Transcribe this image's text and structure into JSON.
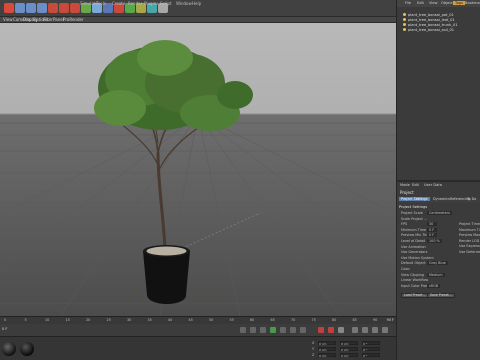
{
  "toolbar": {
    "menus": [
      "Simulate",
      "Tools",
      "Create",
      "Render",
      "Plugins",
      "Script",
      "Window",
      "Help"
    ],
    "icon_colors": [
      "#d94a3a",
      "#6a8fc8",
      "#6a8fc8",
      "#6a8fc8",
      "#c84a3a",
      "#c84a3a",
      "#c84a3a",
      "#68a848",
      "#7aa8d8",
      "#5a78b8",
      "#c84a3a",
      "#58a848",
      "#a8a848",
      "#48a8a8",
      "#a8a8a8"
    ]
  },
  "viewport": {
    "menubar": [
      "View",
      "Cameras",
      "Display",
      "Options",
      "Filter",
      "Panel",
      "ProRender"
    ]
  },
  "object_manager": {
    "tabs": [
      "File",
      "Edit",
      "View",
      "Objects",
      "Tags",
      "Bookmarks"
    ],
    "active_tab": "Tags",
    "objects": [
      {
        "name": "plant_tree_bonsai_pot_01",
        "color": "#e8c060"
      },
      {
        "name": "plant_tree_bonsai_leaf_01",
        "color": "#e8c060"
      },
      {
        "name": "plant_tree_bonsai_trunk_01",
        "color": "#e8c060"
      },
      {
        "name": "plant_tree_bonsai_soil_01",
        "color": "#e8c060"
      }
    ]
  },
  "attributes": {
    "tabs": [
      "Mode",
      "Edit",
      "User Data"
    ],
    "title": "Project",
    "subtabs": [
      "Project Settings",
      "Info",
      "Dynamics",
      "Referencing",
      "To Do"
    ],
    "section": "Project Settings",
    "rows": [
      {
        "label": "Project Scale",
        "value": "Centimeters"
      },
      {
        "label": "Scale Project ...",
        "value": ""
      },
      {
        "label": "FPS",
        "value": "30"
      },
      {
        "label": "Minimum Time",
        "value": "0 F"
      },
      {
        "label": "Preview Min Time",
        "value": "0 F"
      },
      {
        "label": "Level of Detail",
        "value": "100 %"
      },
      {
        "label": "Use Animation",
        "value": ""
      },
      {
        "label": "Use Generators",
        "value": ""
      },
      {
        "label": "Use Motion System",
        "value": ""
      },
      {
        "label": "Default Object Color",
        "value": "Gray Blue"
      },
      {
        "label": "Color",
        "value": ""
      },
      {
        "label": "View Clipping",
        "value": "Medium"
      },
      {
        "label": "Linear Workflow",
        "value": ""
      },
      {
        "label": "Input Color Profile",
        "value": "sRGB"
      }
    ],
    "right_col": [
      "Project Time",
      "Maximum Time",
      "Preview Max Time",
      "Render LOD in Editor",
      "Use Expressions",
      "Use Deformers"
    ],
    "buttons": [
      "Load Preset...",
      "Save Preset..."
    ]
  },
  "timeline": {
    "ticks": [
      "0",
      "5",
      "10",
      "15",
      "20",
      "25",
      "30",
      "35",
      "40",
      "45",
      "50",
      "55",
      "60",
      "65",
      "70",
      "75",
      "80",
      "85",
      "90"
    ],
    "frame_readout": "0 F",
    "end_readout": "90 F"
  },
  "coords": {
    "labels": [
      "X",
      "Y",
      "Z"
    ],
    "values": [
      "0 cm",
      "0 cm",
      "0 cm"
    ],
    "size_values": [
      "0 cm",
      "0 cm",
      "0 cm"
    ],
    "rot_values": [
      "0 °",
      "0 °",
      "0 °"
    ]
  }
}
